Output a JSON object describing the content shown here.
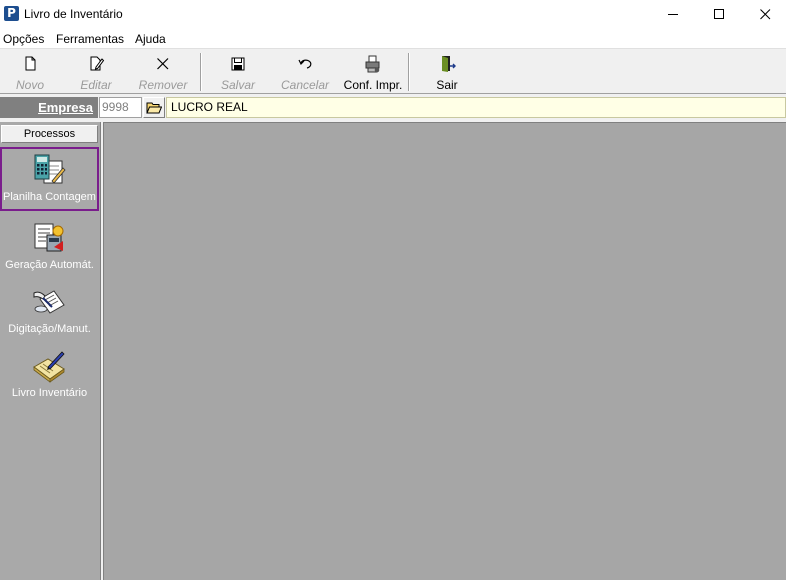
{
  "window": {
    "title": "Livro de Inventário",
    "icon": "app-p-icon",
    "controls": [
      "minimize-icon",
      "maximize-icon",
      "close-icon"
    ]
  },
  "menu": {
    "items": [
      "Opções",
      "Ferramentas",
      "Ajuda"
    ]
  },
  "toolbar": {
    "buttons": [
      {
        "label": "Novo",
        "icon": "new-document-icon",
        "enabled": false
      },
      {
        "label": "Editar",
        "icon": "edit-icon",
        "enabled": false
      },
      {
        "label": "Remover",
        "icon": "remove-icon",
        "enabled": false
      },
      {
        "label": "Salvar",
        "icon": "save-icon",
        "enabled": false
      },
      {
        "label": "Cancelar",
        "icon": "undo-icon",
        "enabled": false
      },
      {
        "label": "Conf. Impr.",
        "icon": "printer-settings-icon",
        "enabled": true
      },
      {
        "label": "Sair",
        "icon": "exit-door-icon",
        "enabled": true
      }
    ]
  },
  "empresa": {
    "label": "Empresa",
    "code": "9998",
    "name": "LUCRO REAL",
    "name_background": "#ffffe6"
  },
  "sidebar": {
    "header": "Processos",
    "items": [
      {
        "label": "Planilha Contagem",
        "icon": "calculator-sheet-icon",
        "active": true
      },
      {
        "label": "Geração Automát.",
        "icon": "auto-generation-icon",
        "active": false
      },
      {
        "label": "Digitação/Manut.",
        "icon": "manual-entry-icon",
        "active": false
      },
      {
        "label": "Livro Inventário",
        "icon": "inventory-book-icon",
        "active": false
      }
    ],
    "active_border_color": "#7a1d8c"
  }
}
